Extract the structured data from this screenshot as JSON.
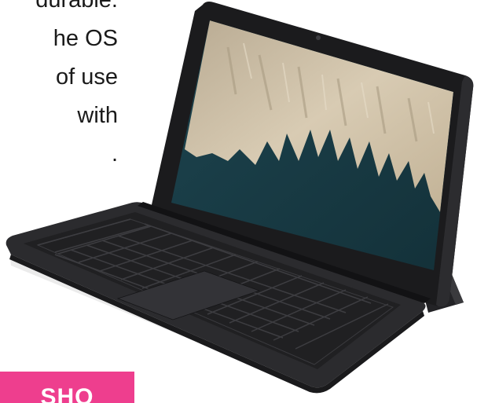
{
  "copy": {
    "lines": [
      "durable.",
      "he OS",
      "of use",
      "with",
      "."
    ]
  },
  "cta": {
    "label": "SHO"
  },
  "product": {
    "icon": "tablet-with-keyboard-icon"
  },
  "colors": {
    "cta_background": "#ee3e8e",
    "text": "#1a1a1a",
    "device_frame": "#1b1b1d",
    "keyboard": "#2a2a2c",
    "screen_water": "#1f4a55",
    "screen_land": "#cdbfa6"
  }
}
